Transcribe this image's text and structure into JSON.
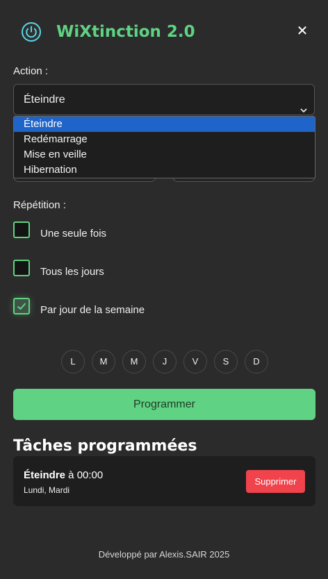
{
  "header": {
    "title": "WiXtinction 2.0",
    "power_icon": "power-icon",
    "close_icon": "close-icon",
    "close_glyph": "✕",
    "accent_color": "#5fd383"
  },
  "action": {
    "label": "Action :",
    "selected": "Éteindre",
    "options": [
      "Éteindre",
      "Redémarrage",
      "Mise en veille",
      "Hibernation"
    ]
  },
  "repetition": {
    "label": "Répétition :",
    "options": [
      {
        "label": "Une seule fois",
        "checked": false
      },
      {
        "label": "Tous les jours",
        "checked": false
      },
      {
        "label": "Par jour de la semaine",
        "checked": true
      }
    ]
  },
  "days": [
    "L",
    "M",
    "M",
    "J",
    "V",
    "S",
    "D"
  ],
  "schedule_button": "Programmer",
  "tasks": {
    "title": "Tâches programmées",
    "items": [
      {
        "action": "Éteindre",
        "time_text": " à 00:00",
        "days": "Lundi, Mardi",
        "delete_label": "Supprimer"
      }
    ]
  },
  "footer": "Développé par Alexis.SAIR 2025",
  "colors": {
    "accent": "#5fd383",
    "danger": "#f0434c",
    "selected_option": "#1f64c8",
    "background": "#2b2b2b"
  }
}
